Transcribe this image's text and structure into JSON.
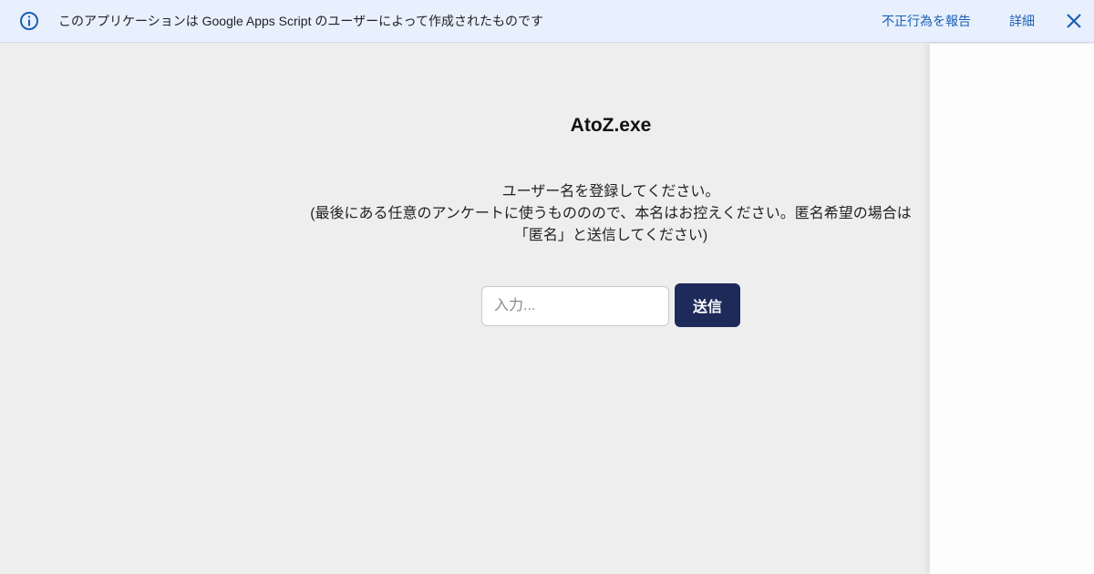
{
  "banner": {
    "icon": "info-icon",
    "message": "このアプリケーションは Google Apps Script のユーザーによって作成されたものです",
    "report_link": "不正行為を報告",
    "details_link": "詳細",
    "close_icon": "close-icon",
    "accent_color": "#1a5fb4",
    "background_color": "#e8f0fe"
  },
  "main": {
    "title": "AtoZ.exe",
    "instructions": {
      "line1": "ユーザー名を登録してください。",
      "line2": "(最後にある任意のアンケートに使うもののので、本名はお控えください。匿名希望の場合は",
      "line3": "「匿名」と送信してください)"
    },
    "input": {
      "placeholder": "入力...",
      "value": ""
    },
    "submit_label": "送信",
    "button_color": "#1e2a5a"
  }
}
